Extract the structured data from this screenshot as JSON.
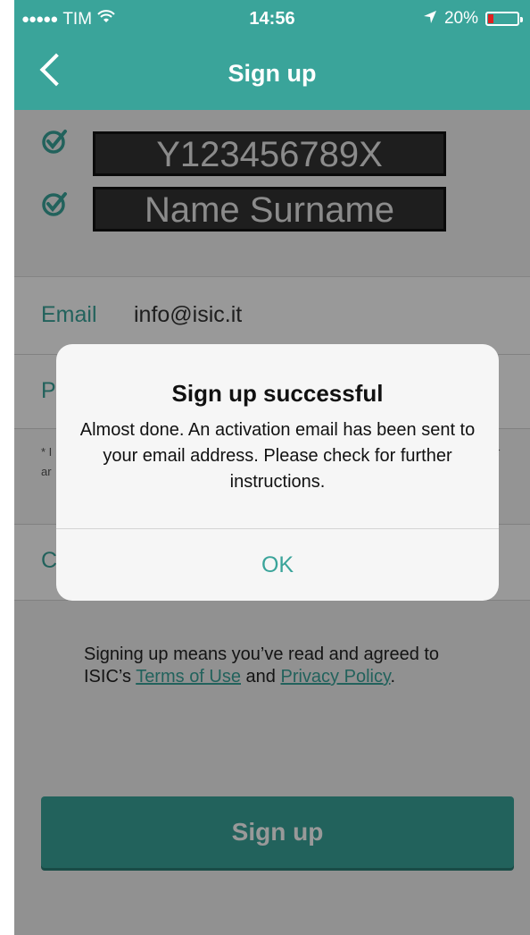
{
  "status_bar": {
    "carrier": "TIM",
    "time": "14:56",
    "battery": "20%",
    "battery_level": 0.2,
    "signal_icon": "signal-dots-icon",
    "wifi_icon": "wifi-icon",
    "location_icon": "location-arrow-icon"
  },
  "nav": {
    "title": "Sign up",
    "back_icon": "chevron-left-icon"
  },
  "card": {
    "id_number": "Y123456789X",
    "name": "Name Surname"
  },
  "form": {
    "email_label": "Email",
    "email_value": "info@isic.it",
    "password_label_partial": "P",
    "note_partial_1": "* I",
    "note_partial_2": "ar",
    "note_partial_right": "r",
    "confirm_label_partial": "C"
  },
  "terms": {
    "prefix": "Signing up means you’ve read and agreed to ISIC’s ",
    "terms_link": "Terms of Use",
    "middle": " and ",
    "privacy_link": "Privacy Policy",
    "suffix": "."
  },
  "signup_button": "Sign up",
  "alert": {
    "title": "Sign up successful",
    "message": "Almost done. An activation email has been sent to your email address. Please check for further instructions.",
    "ok": "OK"
  },
  "colors": {
    "brand": "#3aa49a",
    "battery_low": "#e02020"
  }
}
